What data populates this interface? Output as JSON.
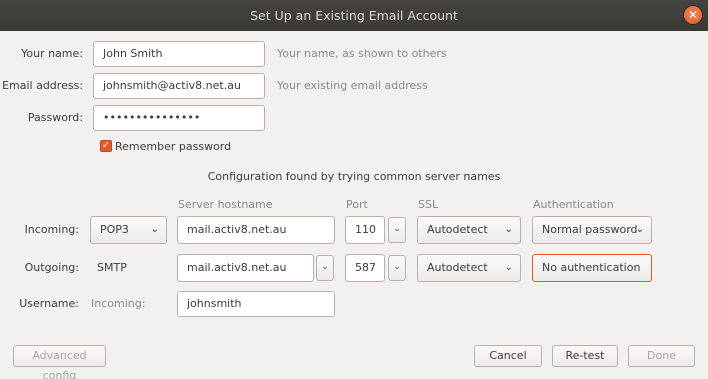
{
  "window": {
    "title": "Set Up an Existing Email Account",
    "close_label": "✕"
  },
  "form": {
    "name_label": "Your name:",
    "name_value": "John Smith",
    "name_hint": "Your name, as shown to others",
    "email_label": "Email address:",
    "email_value": "johnsmith@activ8.net.au",
    "email_hint": "Your existing email address",
    "password_label": "Password:",
    "password_value": "•••••••••••••••",
    "remember_label": "Remember password",
    "remember_checked": true
  },
  "config": {
    "status": "Configuration found by trying common server names",
    "col_hostname": "Server hostname",
    "col_port": "Port",
    "col_ssl": "SSL",
    "col_auth": "Authentication",
    "incoming": {
      "label": "Incoming:",
      "protocol": "POP3",
      "hostname": "mail.activ8.net.au",
      "port": "110",
      "ssl": "Autodetect",
      "auth": "Normal password"
    },
    "outgoing": {
      "label": "Outgoing:",
      "protocol": "SMTP",
      "hostname": "mail.activ8.net.au",
      "port": "587",
      "ssl": "Autodetect",
      "auth": "No authentication"
    },
    "username": {
      "label": "Username:",
      "sublabel": "Incoming:",
      "value": "johnsmith"
    }
  },
  "buttons": {
    "advanced": "Advanced config",
    "cancel": "Cancel",
    "retest": "Re-test",
    "done": "Done"
  },
  "icons": {
    "dropdown": "chevron-down-icon",
    "check": "checkmark-icon"
  },
  "colors": {
    "accent": "#e35a2a",
    "titlebar": "#3d3c38"
  }
}
